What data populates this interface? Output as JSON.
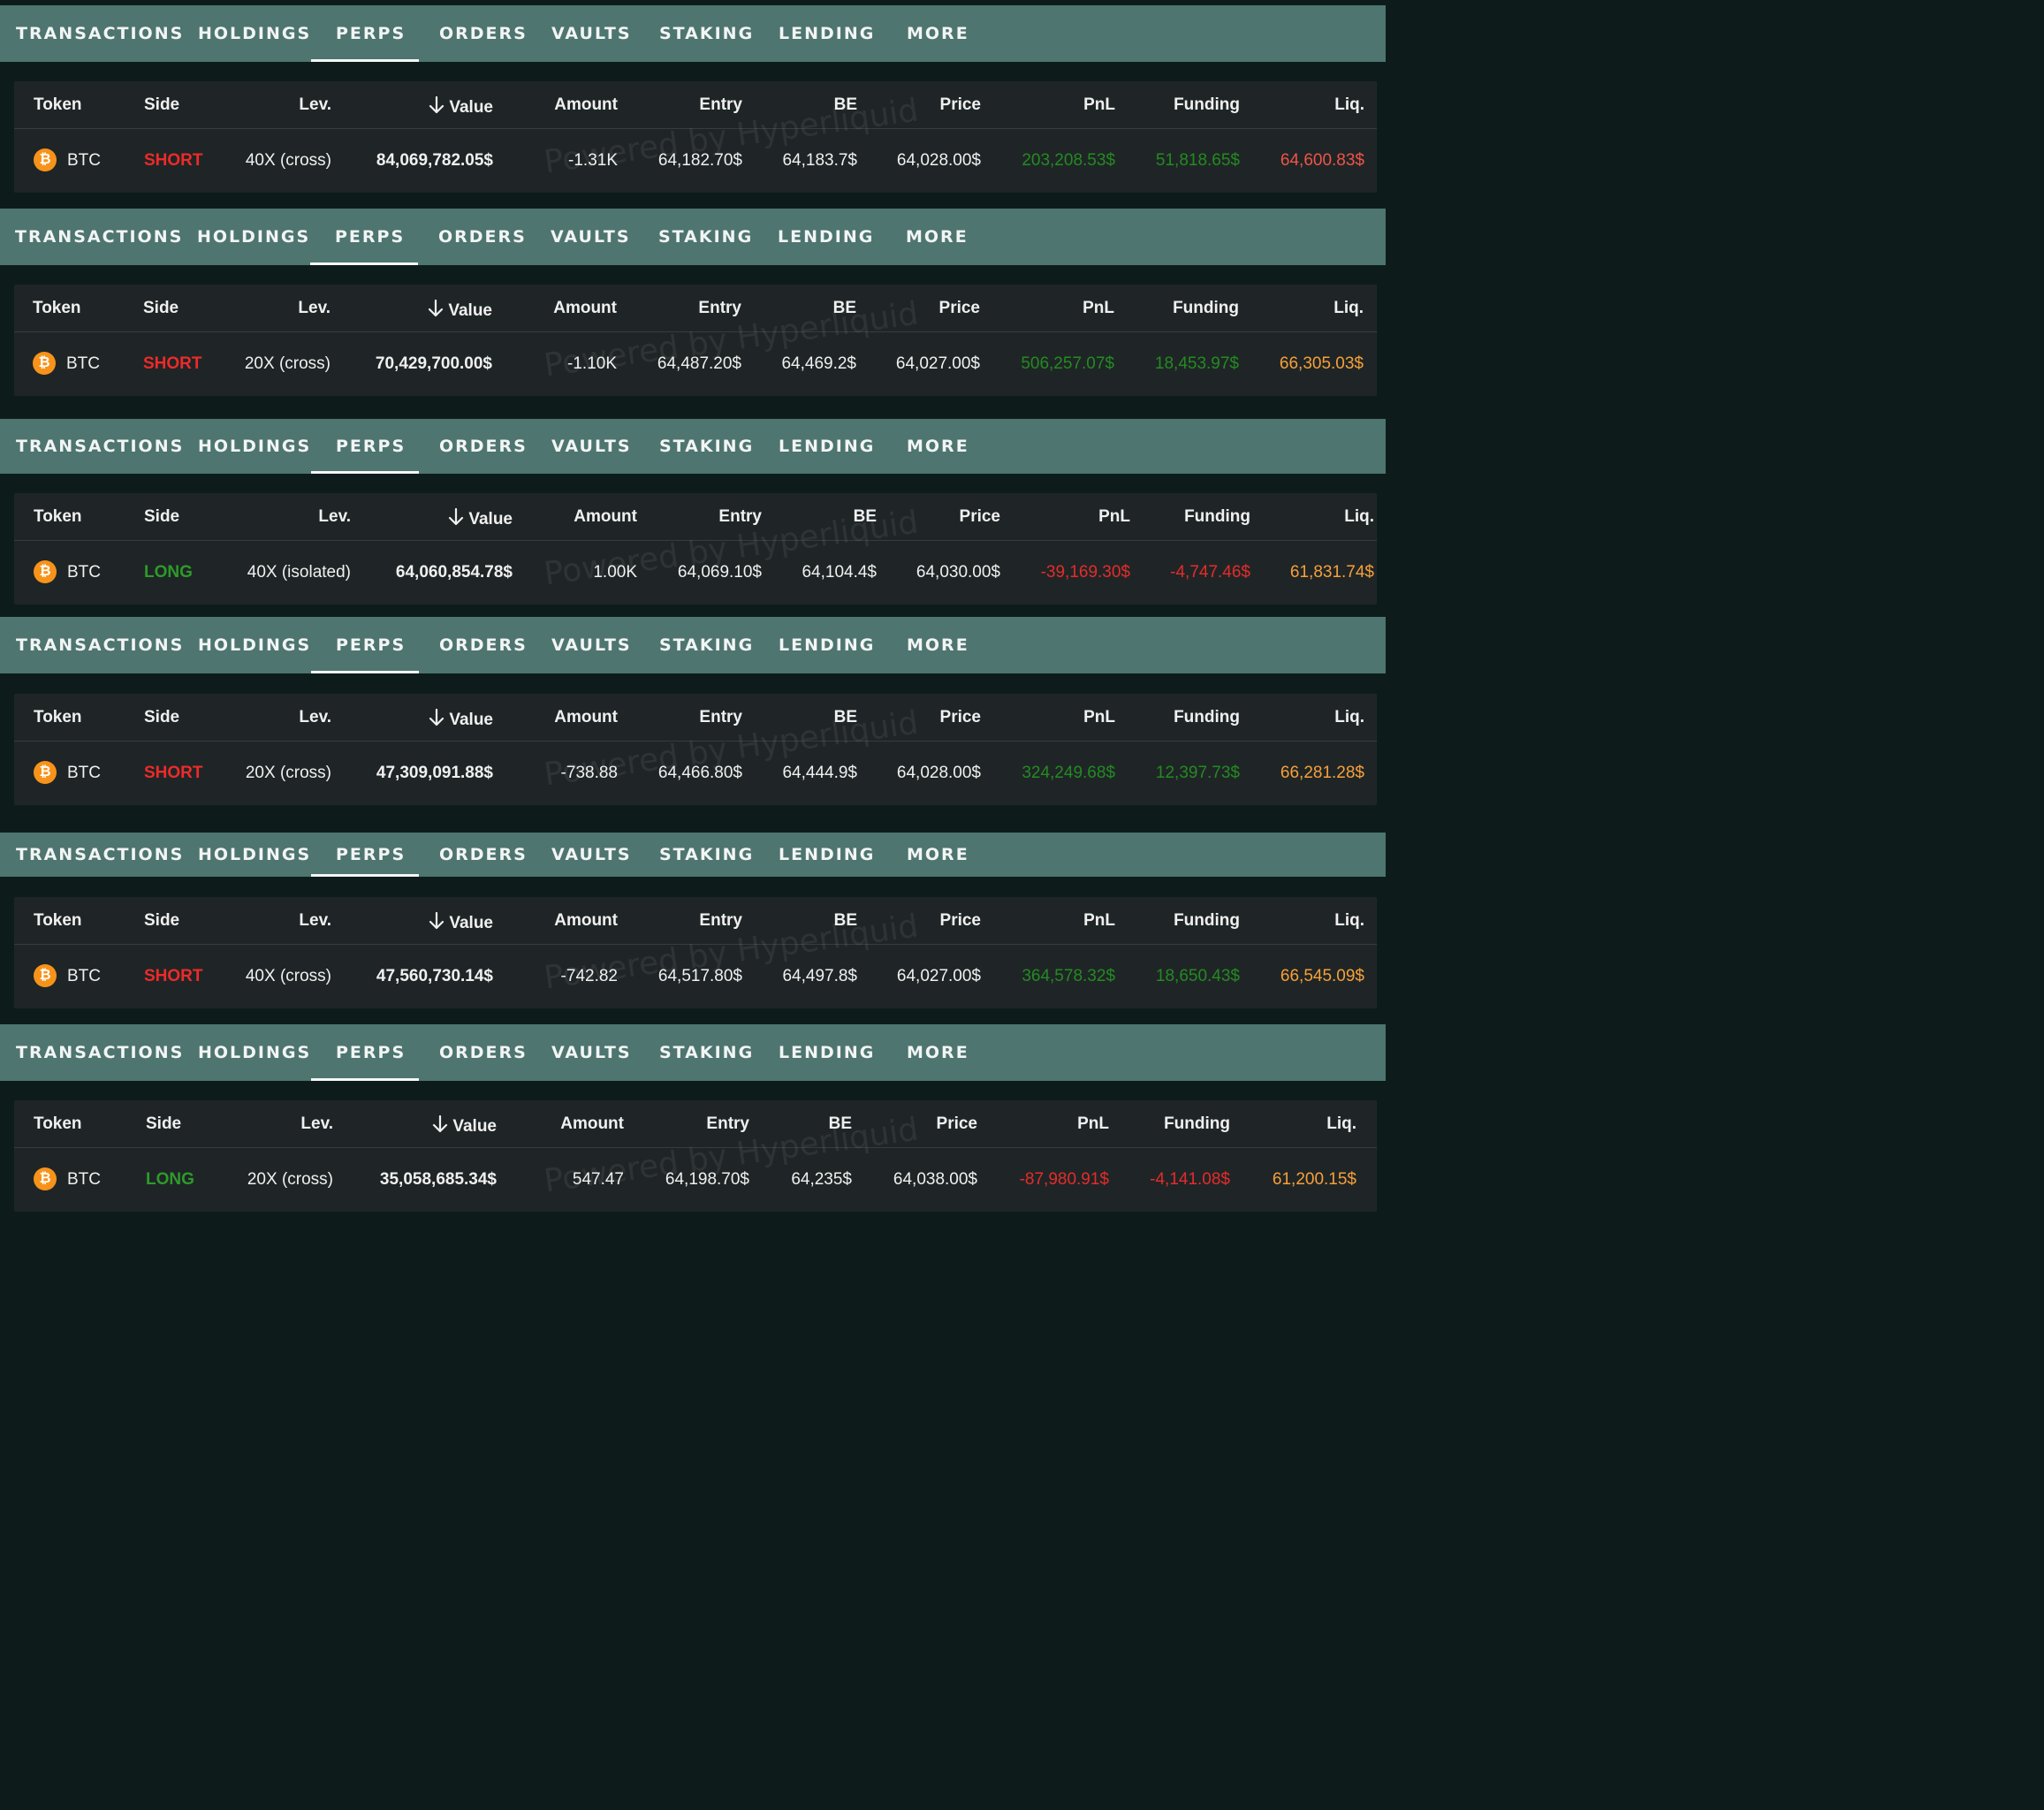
{
  "tabs": [
    "TRANSACTIONS",
    "HOLDINGS",
    "PERPS",
    "ORDERS",
    "VAULTS",
    "STAKING",
    "LENDING",
    "MORE"
  ],
  "active_tab": "PERPS",
  "headers": {
    "token": "Token",
    "side": "Side",
    "lev": "Lev.",
    "value": "Value",
    "amount": "Amount",
    "entry": "Entry",
    "be": "BE",
    "price": "Price",
    "pnl": "PnL",
    "funding": "Funding",
    "liq": "Liq."
  },
  "watermark": "Powered by Hyperliquid",
  "colors": {
    "tab_bar": "#4e7570",
    "table_bg": "#1f2526",
    "short": "#ee2a2a",
    "long": "#2e9a2a",
    "positive": "#248a22",
    "negative": "#e62b2b",
    "liq_orange": "#f6a03a",
    "liq_red": "#ef5448",
    "btc": "#f7931a"
  },
  "panels": [
    {
      "token": "BTC",
      "token_icon": "bitcoin-icon",
      "side": "SHORT",
      "lev": "40X (cross)",
      "value": "84,069,782.05$",
      "amount": "-1.31K",
      "entry": "64,182.70$",
      "be": "64,183.7$",
      "price": "64,028.00$",
      "pnl": "203,208.53$",
      "funding": "51,818.65$",
      "liq": "64,600.83$"
    },
    {
      "token": "BTC",
      "token_icon": "bitcoin-icon",
      "side": "SHORT",
      "lev": "20X (cross)",
      "value": "70,429,700.00$",
      "amount": "-1.10K",
      "entry": "64,487.20$",
      "be": "64,469.2$",
      "price": "64,027.00$",
      "pnl": "506,257.07$",
      "funding": "18,453.97$",
      "liq": "66,305.03$"
    },
    {
      "token": "BTC",
      "token_icon": "bitcoin-icon",
      "side": "LONG",
      "lev": "40X (isolated)",
      "value": "64,060,854.78$",
      "amount": "1.00K",
      "entry": "64,069.10$",
      "be": "64,104.4$",
      "price": "64,030.00$",
      "pnl": "-39,169.30$",
      "funding": "-4,747.46$",
      "liq": "61,831.74$"
    },
    {
      "token": "BTC",
      "token_icon": "bitcoin-icon",
      "side": "SHORT",
      "lev": "20X (cross)",
      "value": "47,309,091.88$",
      "amount": "-738.88",
      "entry": "64,466.80$",
      "be": "64,444.9$",
      "price": "64,028.00$",
      "pnl": "324,249.68$",
      "funding": "12,397.73$",
      "liq": "66,281.28$"
    },
    {
      "token": "BTC",
      "token_icon": "bitcoin-icon",
      "side": "SHORT",
      "lev": "40X (cross)",
      "value": "47,560,730.14$",
      "amount": "-742.82",
      "entry": "64,517.80$",
      "be": "64,497.8$",
      "price": "64,027.00$",
      "pnl": "364,578.32$",
      "funding": "18,650.43$",
      "liq": "66,545.09$"
    },
    {
      "token": "BTC",
      "token_icon": "bitcoin-icon",
      "side": "LONG",
      "lev": "20X (cross)",
      "value": "35,058,685.34$",
      "amount": "547.47",
      "entry": "64,198.70$",
      "be": "64,235$",
      "price": "64,038.00$",
      "pnl": "-87,980.91$",
      "funding": "-4,141.08$",
      "liq": "61,200.15$"
    }
  ]
}
